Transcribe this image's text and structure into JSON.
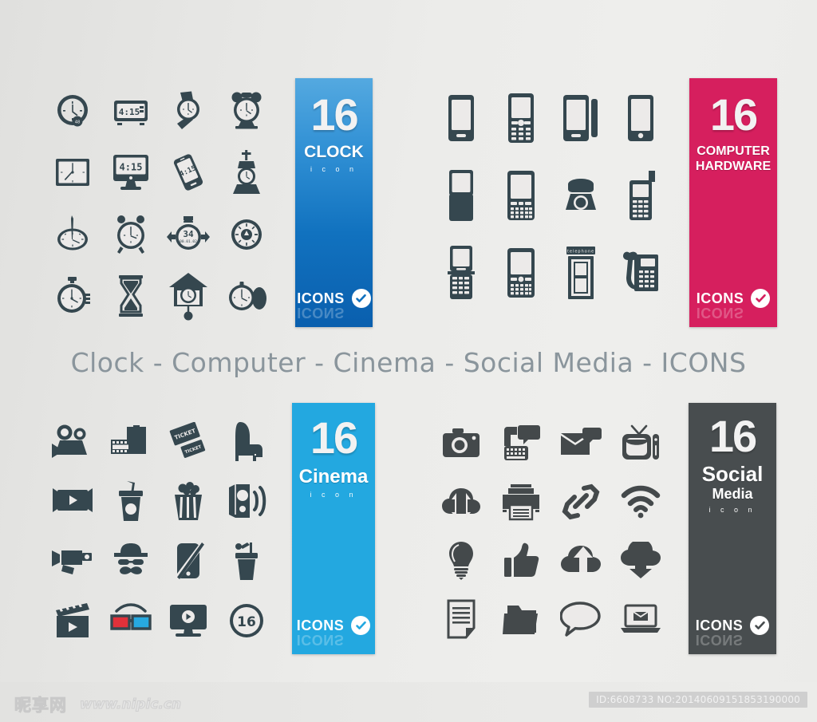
{
  "page": {
    "centre_title": "Clock -  Computer - Cinema - Social Media - ICONS",
    "background_color": "#eaeae8",
    "icon_color": "#35474f"
  },
  "banners": [
    {
      "id": "clock",
      "number": "16",
      "category": "CLOCK",
      "category2": "",
      "subtitle": "i c o n",
      "badge_word": "ICONS",
      "badge_icon": "check-circle-icon",
      "color": "#1172bf"
    },
    {
      "id": "computer",
      "number": "16",
      "category": "COMPUTER",
      "category2": "HARDWARE",
      "subtitle": "",
      "badge_word": "ICONS",
      "badge_icon": "check-circle-icon",
      "color": "#d61f5e"
    },
    {
      "id": "cinema",
      "number": "16",
      "category": "Cinema",
      "category2": "",
      "subtitle": "i c o n",
      "badge_word": "ICONS",
      "badge_icon": "check-circle-icon",
      "color": "#23a8e0"
    },
    {
      "id": "social",
      "number": "16",
      "category": "Social",
      "category2": "Media",
      "subtitle": "i c o n",
      "badge_word": "ICONS",
      "badge_icon": "check-circle-icon",
      "color": "#484d4f"
    }
  ],
  "sets": {
    "clock": {
      "label": "Clock icons",
      "icons": [
        {
          "name": "wall-clock-icon",
          "text": ""
        },
        {
          "name": "digital-alarm-clock-icon",
          "text": "4:15"
        },
        {
          "name": "wristwatch-icon",
          "text": ""
        },
        {
          "name": "twin-bell-alarm-clock-icon",
          "text": ""
        },
        {
          "name": "square-wall-clock-icon",
          "text": ""
        },
        {
          "name": "desktop-monitor-clock-icon",
          "text": "4:15"
        },
        {
          "name": "smartphone-clock-icon",
          "text": "4:15"
        },
        {
          "name": "church-tower-clock-icon",
          "text": ""
        },
        {
          "name": "oval-clock-icon",
          "text": ""
        },
        {
          "name": "alarm-clock-icon",
          "text": ""
        },
        {
          "name": "stopwatch-24h-icon",
          "text": "34"
        },
        {
          "name": "sun-dial-clock-icon",
          "text": ""
        },
        {
          "name": "stopwatch-icon",
          "text": ""
        },
        {
          "name": "hourglass-icon",
          "text": ""
        },
        {
          "name": "cuckoo-clock-icon",
          "text": ""
        },
        {
          "name": "pocket-watch-icon",
          "text": ""
        }
      ]
    },
    "computer": {
      "label": "Computer hardware icons",
      "icons": [
        {
          "name": "smartphone-icon",
          "text": ""
        },
        {
          "name": "feature-phone-keypad-icon",
          "text": ""
        },
        {
          "name": "tablet-with-case-icon",
          "text": ""
        },
        {
          "name": "smartphone-home-button-icon",
          "text": ""
        },
        {
          "name": "slider-phone-icon",
          "text": ""
        },
        {
          "name": "qwerty-phone-icon",
          "text": ""
        },
        {
          "name": "rotary-telephone-icon",
          "text": ""
        },
        {
          "name": "candybar-phone-icon",
          "text": ""
        },
        {
          "name": "flip-phone-icon",
          "text": ""
        },
        {
          "name": "blackberry-phone-icon",
          "text": ""
        },
        {
          "name": "telephone-booth-icon",
          "text": "telephone"
        },
        {
          "name": "desk-phone-icon",
          "text": ""
        }
      ]
    },
    "cinema": {
      "label": "Cinema icons",
      "icons": [
        {
          "name": "film-camera-icon",
          "text": ""
        },
        {
          "name": "film-reel-strip-icon",
          "text": ""
        },
        {
          "name": "movie-tickets-icon",
          "text": "TICKET"
        },
        {
          "name": "cinema-seat-icon",
          "text": ""
        },
        {
          "name": "cinema-screen-icon",
          "text": ""
        },
        {
          "name": "soda-cup-icon",
          "text": ""
        },
        {
          "name": "popcorn-bucket-icon",
          "text": ""
        },
        {
          "name": "loudspeaker-icon",
          "text": ""
        },
        {
          "name": "old-film-camera-icon",
          "text": ""
        },
        {
          "name": "mustache-hat-icon",
          "text": ""
        },
        {
          "name": "no-phone-icon",
          "text": ""
        },
        {
          "name": "drink-cup-icon",
          "text": ""
        },
        {
          "name": "clapperboard-play-icon",
          "text": ""
        },
        {
          "name": "3d-glasses-icon",
          "text": ""
        },
        {
          "name": "tv-play-icon",
          "text": ""
        },
        {
          "name": "age-rating-16-icon",
          "text": "16"
        }
      ]
    },
    "social": {
      "label": "Social media icons",
      "icons": [
        {
          "name": "photo-camera-icon",
          "text": ""
        },
        {
          "name": "chat-keyboard-icon",
          "text": ""
        },
        {
          "name": "email-chat-icon",
          "text": ""
        },
        {
          "name": "television-icon",
          "text": ""
        },
        {
          "name": "cloud-transfer-icon",
          "text": ""
        },
        {
          "name": "printer-icon",
          "text": ""
        },
        {
          "name": "link-chain-icon",
          "text": ""
        },
        {
          "name": "wifi-icon",
          "text": ""
        },
        {
          "name": "lightbulb-icon",
          "text": ""
        },
        {
          "name": "thumbs-up-icon",
          "text": ""
        },
        {
          "name": "cloud-upload-icon",
          "text": ""
        },
        {
          "name": "cloud-download-icon",
          "text": ""
        },
        {
          "name": "document-icon",
          "text": ""
        },
        {
          "name": "folder-icon",
          "text": ""
        },
        {
          "name": "speech-bubble-icon",
          "text": ""
        },
        {
          "name": "laptop-email-icon",
          "text": ""
        }
      ]
    }
  },
  "footer": {
    "watermark_logo": "昵享网",
    "watermark_url": "www.nipic.cn",
    "id_text": "ID:6608733 NO:20140609151853190000"
  }
}
